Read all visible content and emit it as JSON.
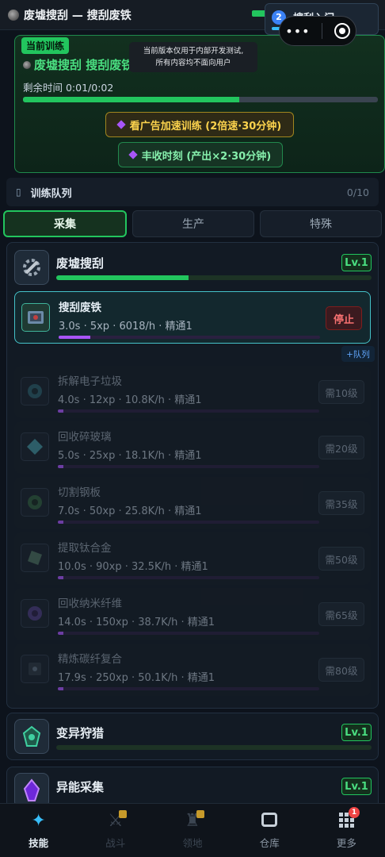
{
  "header": {
    "title": "废墟搜刮 — 搜刮废铁",
    "tutorial": {
      "step": "2",
      "label": "搜刮入门",
      "progress": 0.4
    }
  },
  "training": {
    "badge": "当前训练",
    "name": "废墟搜刮  搜刮废铁",
    "notice_line1": "当前版本仅用于内部开发测试,",
    "notice_line2": "所有内容均不面向用户",
    "remaining": "剩余时间 0:01/0:02",
    "progress": 0.61,
    "ad_button": "看广告加速训练 (2倍速·30分钟)",
    "harvest_button": "丰收时刻 (产出×2·30分钟)",
    "capsule_dots": "•••"
  },
  "queue": {
    "label": "训练队列",
    "count": "0/10"
  },
  "tabs": [
    {
      "label": "采集",
      "active": true
    },
    {
      "label": "生产",
      "active": false
    },
    {
      "label": "特殊",
      "active": false
    }
  ],
  "skills": [
    {
      "name": "废墟搜刮",
      "level": "Lv.1",
      "xp": 0.42
    },
    {
      "name": "变异狩猎",
      "level": "Lv.1",
      "xp": 0
    },
    {
      "name": "异能采集",
      "level": "Lv.1",
      "xp": 0
    }
  ],
  "tasks": [
    {
      "name": "搜刮废铁",
      "stats": "3.0s · 5xp · 6018/h · 精通1",
      "progress": 0.12,
      "action": "停止",
      "active": true
    },
    {
      "name": "拆解电子垃圾",
      "stats": "4.0s · 12xp · 10.8K/h · 精通1",
      "progress": 0.02,
      "action": "需10级",
      "active": false
    },
    {
      "name": "回收碎玻璃",
      "stats": "5.0s · 25xp · 18.1K/h · 精通1",
      "progress": 0.02,
      "action": "需20级",
      "active": false
    },
    {
      "name": "切割钢板",
      "stats": "7.0s · 50xp · 25.8K/h · 精通1",
      "progress": 0.02,
      "action": "需35级",
      "active": false
    },
    {
      "name": "提取钛合金",
      "stats": "10.0s · 90xp · 32.5K/h · 精通1",
      "progress": 0.02,
      "action": "需50级",
      "active": false
    },
    {
      "name": "回收纳米纤维",
      "stats": "14.0s · 150xp · 38.7K/h · 精通1",
      "progress": 0.02,
      "action": "需65级",
      "active": false
    },
    {
      "name": "精炼碳纤复合",
      "stats": "17.9s · 250xp · 50.1K/h · 精通1",
      "progress": 0.02,
      "action": "需80级",
      "active": false
    }
  ],
  "queue_add": "+队列",
  "nav": [
    {
      "label": "技能",
      "icon": "sparkle-icon",
      "state": "active"
    },
    {
      "label": "战斗",
      "icon": "swords-icon",
      "state": "locked"
    },
    {
      "label": "领地",
      "icon": "castle-icon",
      "state": "locked"
    },
    {
      "label": "仓库",
      "icon": "storage-icon",
      "state": "normal"
    },
    {
      "label": "更多",
      "icon": "grid-icon",
      "state": "normal",
      "badge": "1"
    }
  ],
  "colors": {
    "accent": "#22c55e",
    "active_border": "#45c2c9",
    "xp_bar": "#a855f7",
    "stop": "#f87171"
  }
}
